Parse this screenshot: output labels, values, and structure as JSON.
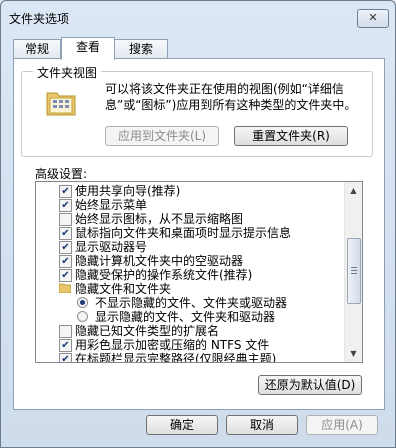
{
  "window": {
    "title": "文件夹选项",
    "close_glyph": "✕"
  },
  "tabs": [
    {
      "label": "常规",
      "active": false
    },
    {
      "label": "查看",
      "active": true
    },
    {
      "label": "搜索",
      "active": false
    }
  ],
  "folder_views": {
    "title": "文件夹视图",
    "description": "可以将该文件夹正在使用的视图(例如“详细信息”或“图标”)应用到所有这种类型的文件夹中。",
    "apply_button": "应用到文件夹(L)",
    "reset_button": "重置文件夹(R)",
    "icon": "folder-view-icon"
  },
  "advanced": {
    "label": "高级设置:",
    "items": [
      {
        "type": "checkbox",
        "checked": true,
        "label": "使用共享向导(推荐)"
      },
      {
        "type": "checkbox",
        "checked": true,
        "label": "始终显示菜单"
      },
      {
        "type": "checkbox",
        "checked": false,
        "label": "始终显示图标，从不显示缩略图"
      },
      {
        "type": "checkbox",
        "checked": true,
        "label": "鼠标指向文件夹和桌面项时显示提示信息"
      },
      {
        "type": "checkbox",
        "checked": true,
        "label": "显示驱动器号"
      },
      {
        "type": "checkbox",
        "checked": true,
        "label": "隐藏计算机文件夹中的空驱动器"
      },
      {
        "type": "checkbox",
        "checked": true,
        "label": "隐藏受保护的操作系统文件(推荐)"
      },
      {
        "type": "folder",
        "label": "隐藏文件和文件夹"
      },
      {
        "type": "radio",
        "checked": true,
        "label": "不显示隐藏的文件、文件夹或驱动器"
      },
      {
        "type": "radio",
        "checked": false,
        "label": "显示隐藏的文件、文件夹和驱动器"
      },
      {
        "type": "checkbox",
        "checked": false,
        "label": "隐藏已知文件类型的扩展名"
      },
      {
        "type": "checkbox",
        "checked": true,
        "label": "用彩色显示加密或压缩的 NTFS 文件"
      },
      {
        "type": "checkbox",
        "checked": true,
        "label": "在标题栏显示完整路径(仅限经典主题)"
      }
    ],
    "restore_button": "还原为默认值(D)"
  },
  "footer": {
    "ok": "确定",
    "cancel": "取消",
    "apply": "应用(A)"
  }
}
